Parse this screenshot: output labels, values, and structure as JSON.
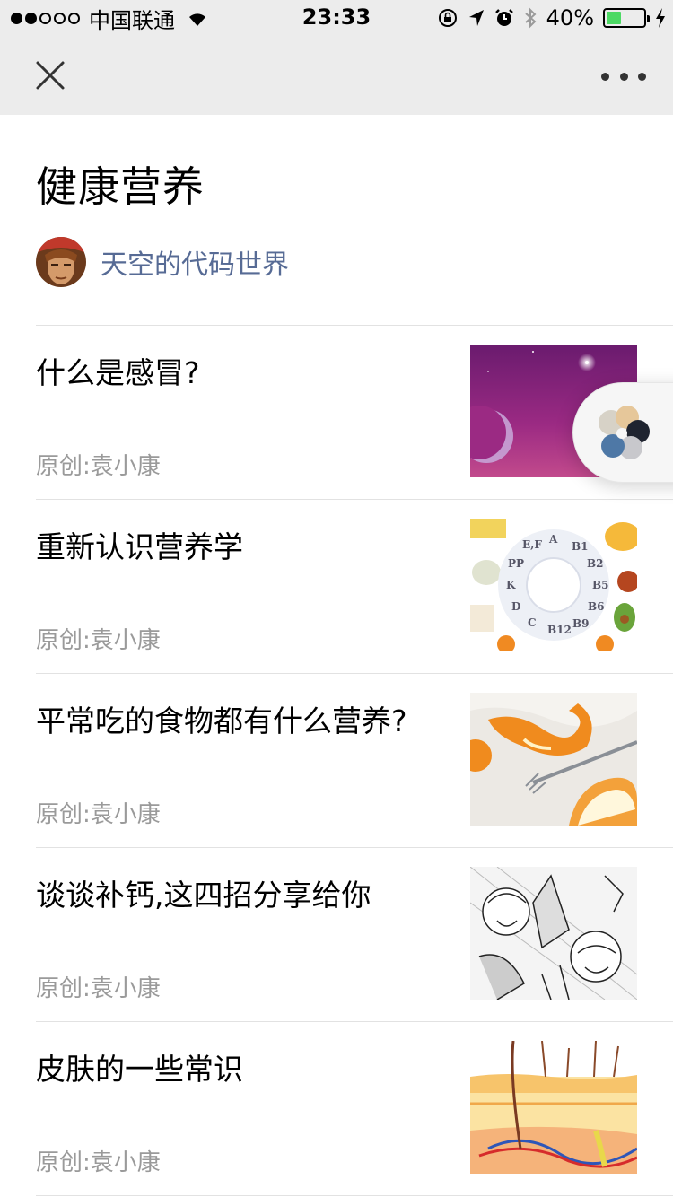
{
  "status_bar": {
    "carrier": "中国联通",
    "time": "23:33",
    "battery": "40%",
    "battery_level": 0.4,
    "signal_bars": 2
  },
  "nav": {
    "close_icon": "close-icon",
    "more_icon": "more-icon"
  },
  "page": {
    "title": "健康营养",
    "author": "天空的代码世界"
  },
  "articles": [
    {
      "title": "什么是感冒?",
      "meta": "原创:袁小康",
      "thumb": "night-sky-moon"
    },
    {
      "title": "重新认识营养学",
      "meta": "原创:袁小康",
      "thumb": "vitamin-wheel",
      "thumb_labels": [
        "A",
        "B1",
        "B2",
        "B5",
        "B6",
        "B9",
        "B12",
        "C",
        "D",
        "K",
        "PP",
        "E,F"
      ]
    },
    {
      "title": "平常吃的食物都有什么营养?",
      "meta": "原创:袁小康",
      "thumb": "orange-peel-fork"
    },
    {
      "title": "谈谈补钙,这四招分享给你",
      "meta": "原创:袁小康",
      "thumb": "manga-illustration"
    },
    {
      "title": "皮肤的一些常识",
      "meta": "原创:袁小康",
      "thumb": "skin-cross-section"
    }
  ],
  "colors": {
    "link": "#576b95",
    "meta": "#9a9a9a",
    "bar_bg": "#ececec",
    "battery_fill": "#4cd964"
  }
}
